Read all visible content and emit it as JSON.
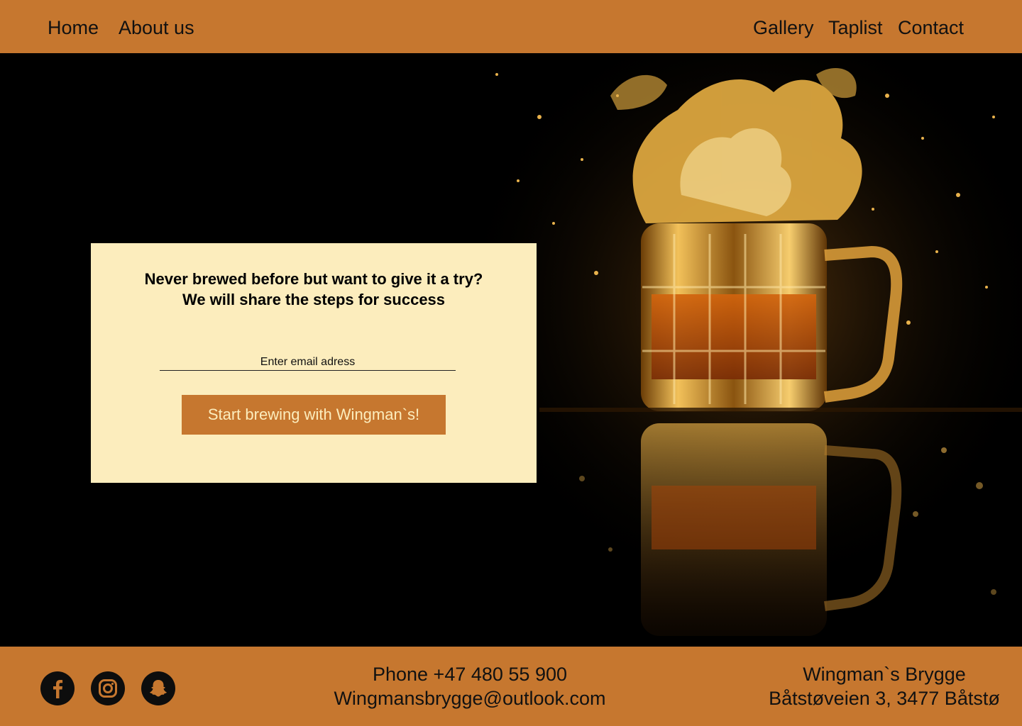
{
  "nav": {
    "left": [
      "Home",
      "About us"
    ],
    "right": [
      "Gallery",
      "Taplist",
      "Contact"
    ]
  },
  "hero": {
    "image_icon": "beer-mug-splash-photo"
  },
  "signup": {
    "heading_line1": "Never brewed before but want to give it a try?",
    "heading_line2": "We will share the steps for success",
    "email_placeholder": "Enter email adress",
    "button_label": "Start brewing with Wingman`s!"
  },
  "footer": {
    "social": [
      "facebook-icon",
      "instagram-icon",
      "snapchat-icon"
    ],
    "phone": "Phone +47  480 55 900",
    "email": "Wingmansbrygge@outlook.com",
    "company": "Wingman`s Brygge",
    "address": "Båtstøveien 3, 3477 Båtstø"
  },
  "colors": {
    "accent": "#c6772f",
    "card_background": "#fcedbd",
    "background": "#000000",
    "text": "#111111"
  }
}
